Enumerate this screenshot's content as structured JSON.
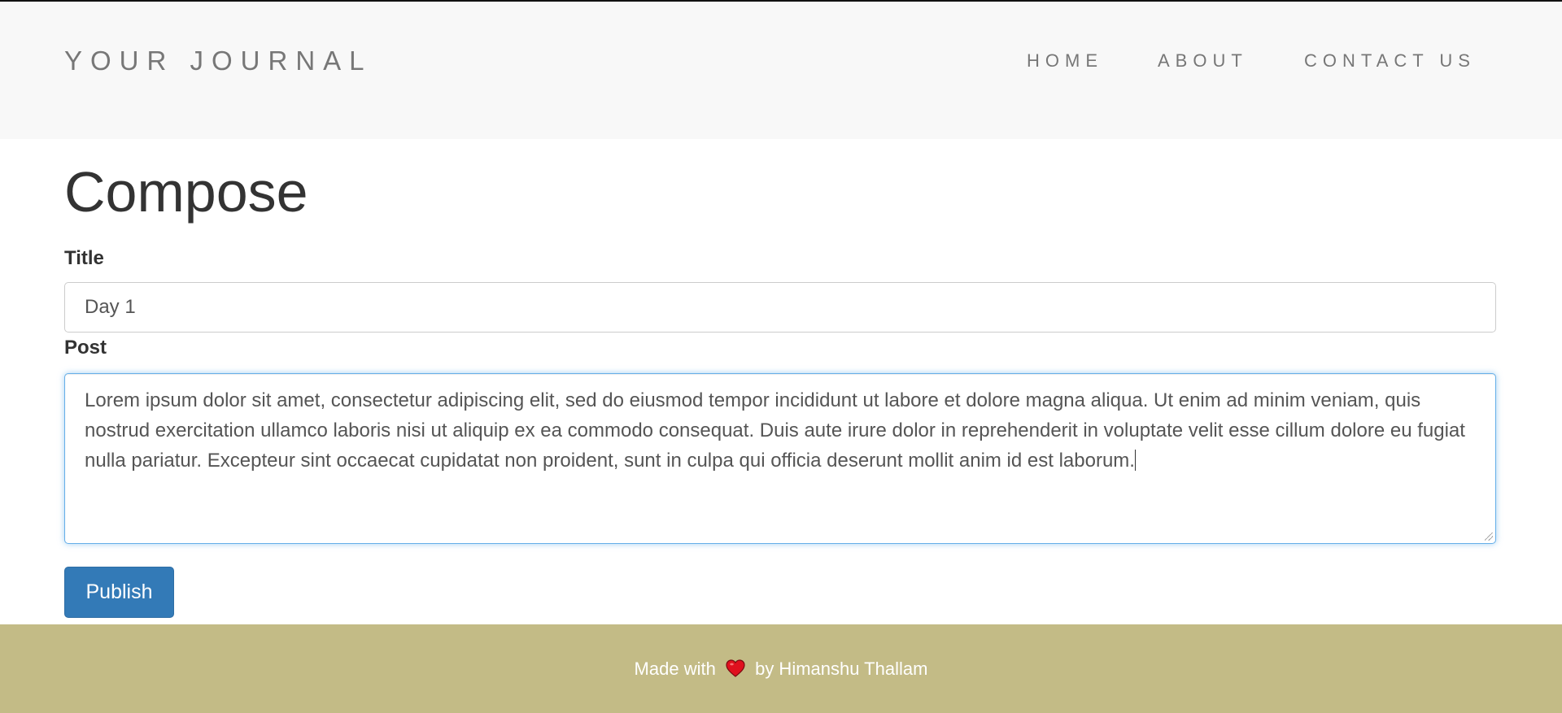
{
  "header": {
    "brand": "YOUR JOURNAL",
    "nav": {
      "home": "HOME",
      "about": "ABOUT",
      "contact": "CONTACT US"
    }
  },
  "compose": {
    "heading": "Compose",
    "title_label": "Title",
    "title_value": "Day 1",
    "post_label": "Post",
    "post_value": "Lorem ipsum dolor sit amet, consectetur adipiscing elit, sed do eiusmod tempor incididunt ut labore et dolore magna aliqua. Ut enim ad minim veniam, quis nostrud exercitation ullamco laboris nisi ut aliquip ex ea commodo consequat. Duis aute irure dolor in reprehenderit in voluptate velit esse cillum dolore eu fugiat nulla pariatur. Excepteur sint occaecat cupidatat non proident, sunt in culpa qui officia deserunt mollit anim id est laborum.",
    "publish_label": "Publish"
  },
  "footer": {
    "made_with": "Made with",
    "icon": "heart-icon",
    "by": "by Himanshu Thallam"
  },
  "colors": {
    "primary_button": "#337ab7",
    "footer_bg": "#c3bb86",
    "navbar_bg": "#f8f8f8",
    "focus_border": "#66afe9",
    "heart": "#e0101e"
  }
}
